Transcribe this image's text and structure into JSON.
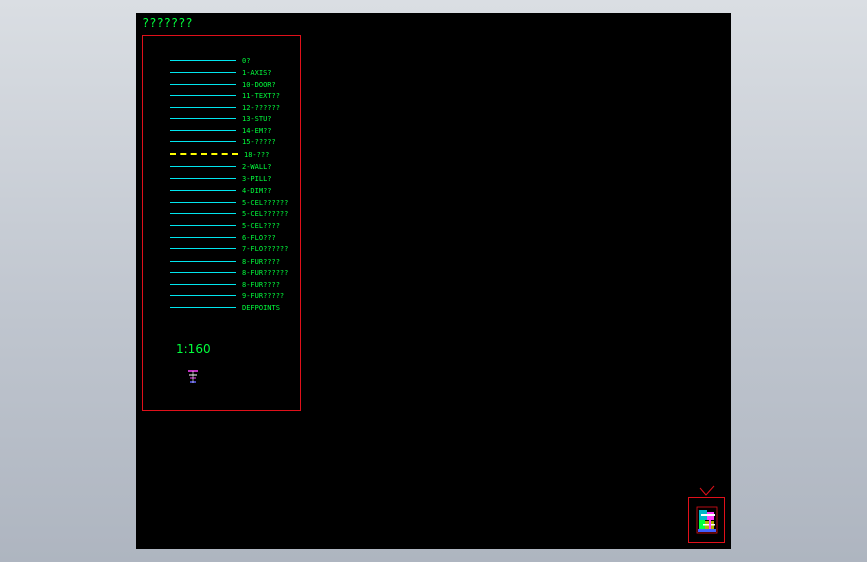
{
  "drawing": {
    "title": "???????",
    "scale": "1:160"
  },
  "legend": {
    "layers": [
      {
        "label": "0?",
        "style": "solid"
      },
      {
        "label": "1-AXIS?",
        "style": "solid"
      },
      {
        "label": "10-DOOR?",
        "style": "solid"
      },
      {
        "label": "11-TEXT??",
        "style": "solid"
      },
      {
        "label": "12-??????",
        "style": "solid"
      },
      {
        "label": "13-STU?",
        "style": "solid"
      },
      {
        "label": "14-EM??",
        "style": "solid"
      },
      {
        "label": "15-?????",
        "style": "solid"
      },
      {
        "label": "18-???",
        "style": "dashed"
      },
      {
        "label": "2-WALL?",
        "style": "solid"
      },
      {
        "label": "3-PILL?",
        "style": "solid"
      },
      {
        "label": "4-DIM??",
        "style": "solid"
      },
      {
        "label": "5-CEL??????",
        "style": "solid"
      },
      {
        "label": "5-CEL??????",
        "style": "solid"
      },
      {
        "label": "5-CEL????",
        "style": "solid"
      },
      {
        "label": "6-FLO???",
        "style": "solid"
      },
      {
        "label": "7-FLO??????",
        "style": "solid"
      },
      {
        "label": "8-FUR????",
        "style": "solid"
      },
      {
        "label": "8-FUR??????",
        "style": "solid"
      },
      {
        "label": "8-FUR????",
        "style": "solid"
      },
      {
        "label": "9-FUR?????",
        "style": "solid"
      },
      {
        "label": "DEFPOINTS",
        "style": "solid"
      }
    ]
  },
  "colors": {
    "canvas": "#000000",
    "text": "#00ff3c",
    "frame": "#e0101a",
    "line": "#00e6ee",
    "dashed": "#ffff00"
  }
}
